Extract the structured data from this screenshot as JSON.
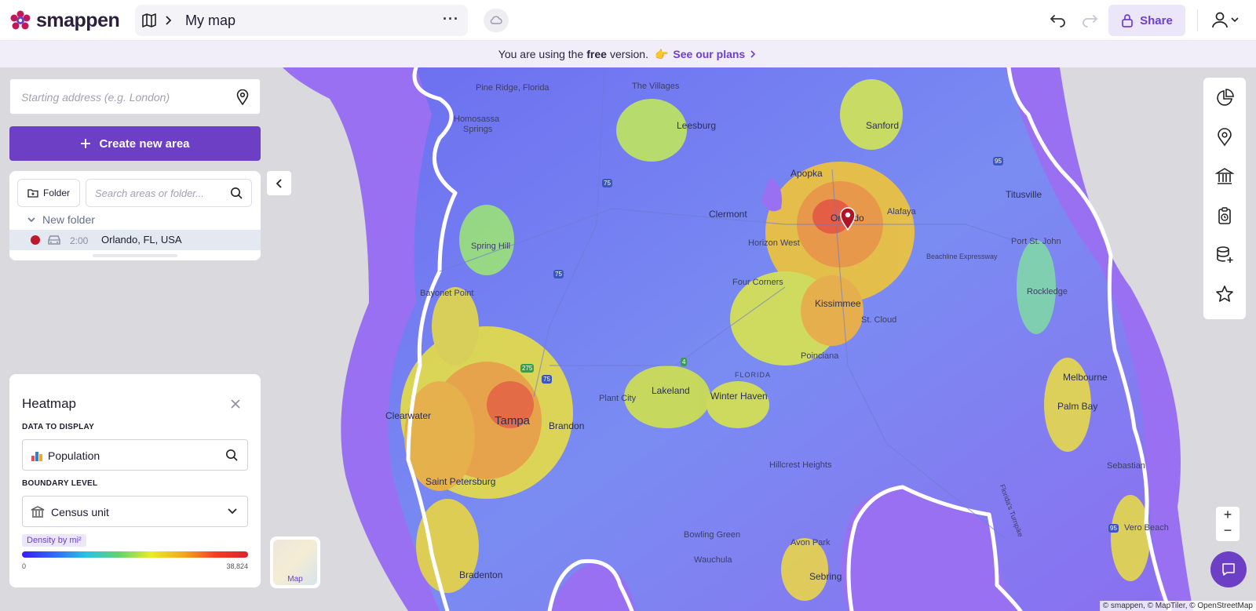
{
  "app": {
    "logo_text": "smappen",
    "map_title": "My map"
  },
  "toolbar": {
    "share_label": "Share",
    "more_icon": "more-dots-icon",
    "cloud_icon": "cloud-sync-icon"
  },
  "banner": {
    "prefix": "You are using the",
    "free": "free",
    "suffix": "version.",
    "emoji": "👉",
    "cta": "See our plans"
  },
  "left_panel": {
    "address_placeholder": "Starting address (e.g. London)",
    "create_label": "Create new area",
    "folder_label": "Folder",
    "search_placeholder": "Search areas or folder...",
    "folder_name": "New folder",
    "areas": [
      {
        "time": "2:00",
        "name": "Orlando, FL, USA",
        "color": "#c0182a"
      }
    ]
  },
  "heatmap": {
    "title": "Heatmap",
    "data_label": "DATA TO DISPLAY",
    "data_value": "Population",
    "boundary_label": "BOUNDARY LEVEL",
    "boundary_value": "Census unit",
    "legend_title": "Density by mi²",
    "legend_min": "0",
    "legend_max": "38,824"
  },
  "map_switch": {
    "label": "Map"
  },
  "map": {
    "labels": {
      "the_villages": "The Villages",
      "pine_ridge": "Pine Ridge, Florida",
      "homosassa": "Homosassa",
      "springs": "Springs",
      "leesburg": "Leesburg",
      "sanford": "Sanford",
      "apopka": "Apopka",
      "titusville": "Titusville",
      "clermont": "Clermont",
      "orlando": "Orlando",
      "alafaya": "Alafaya",
      "horizon_west": "Horizon West",
      "port_st_john": "Port St. John",
      "beachline": "Beachline Expressway",
      "spring_hill": "Spring Hill",
      "four_corners": "Four Corners",
      "rockledge": "Rockledge",
      "bayonet_point": "Bayonet Point",
      "kissimmee": "Kissimmee",
      "st_cloud": "St. Cloud",
      "poinciana": "Poinciana",
      "melbourne": "Melbourne",
      "palm_bay": "Palm Bay",
      "lakeland": "Lakeland",
      "plant_city": "Plant City",
      "winter_haven": "Winter Haven",
      "florida": "FLORIDA",
      "clearwater": "Clearwater",
      "tampa": "Tampa",
      "brandon": "Brandon",
      "saint_petersburg": "Saint Petersburg",
      "hillcrest_heights": "Hillcrest Heights",
      "sebastian": "Sebastian",
      "bowling_green": "Bowling Green",
      "avon_park": "Avon Park",
      "wauchula": "Wauchula",
      "sebring": "Sebring",
      "bradenton": "Bradenton",
      "vero_beach": "Vero Beach",
      "florida_turnpike": "Florida's Turnpike"
    },
    "attribution": "© smappen, © MapTiler, © OpenStreetMap"
  },
  "colors": {
    "accent": "#6c3fc4",
    "isochrone_fill": "#9b6df0",
    "banner_bg": "#f1edf9"
  }
}
